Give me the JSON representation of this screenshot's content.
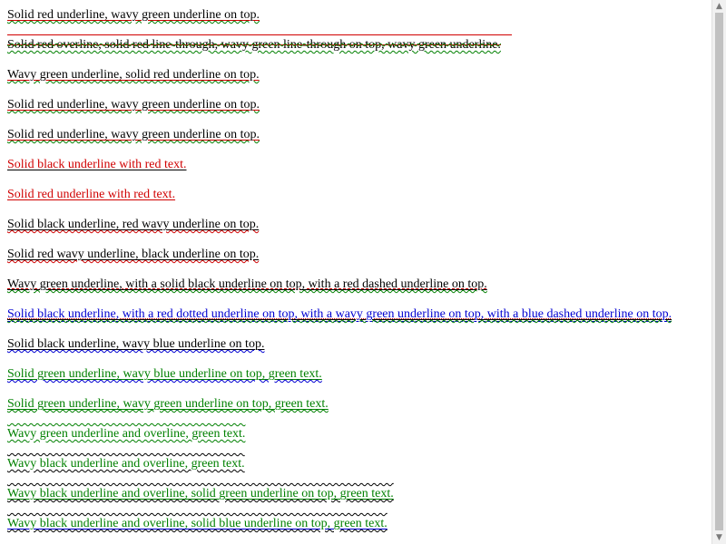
{
  "lines": [
    "Solid red underline, wavy green underline on top.",
    "Solid red overline, solid red line-through, wavy green line-through on top, wavy green underline.",
    "Wavy green underline, solid red underline on top.",
    "Solid red underline, wavy green underline on top.",
    "Solid red underline, wavy green underline on top.",
    "Solid black underline with red text.",
    "Solid red underline with red text.",
    "Solid black underline, red wavy underline on top.",
    "Solid red wavy underline, black underline on top.",
    "Wavy green underline, with a solid black underline on top, with a red dashed underline on top.",
    "Solid black underline, with a red dotted underline on top, with a wavy green underline on top, with a blue dashed underline on top.",
    "Solid black underline, wavy blue underline on top.",
    "Solid green underline, wavy blue underline on top, green text.",
    "Solid green underline, wavy green underline on top, green text.",
    "Wavy green underline and overline, green text.",
    "Wavy black underline and overline, green text.",
    "Wavy black underline and overline, solid green underline on top, green text.",
    "Wavy black underline and overline, solid blue underline on top, green text."
  ],
  "scrollbar": {
    "up_icon": "▲",
    "down_icon": "▼"
  },
  "colors": {
    "red": "#d00000",
    "green": "#008000",
    "blue": "#0000d0",
    "black": "#000000"
  }
}
